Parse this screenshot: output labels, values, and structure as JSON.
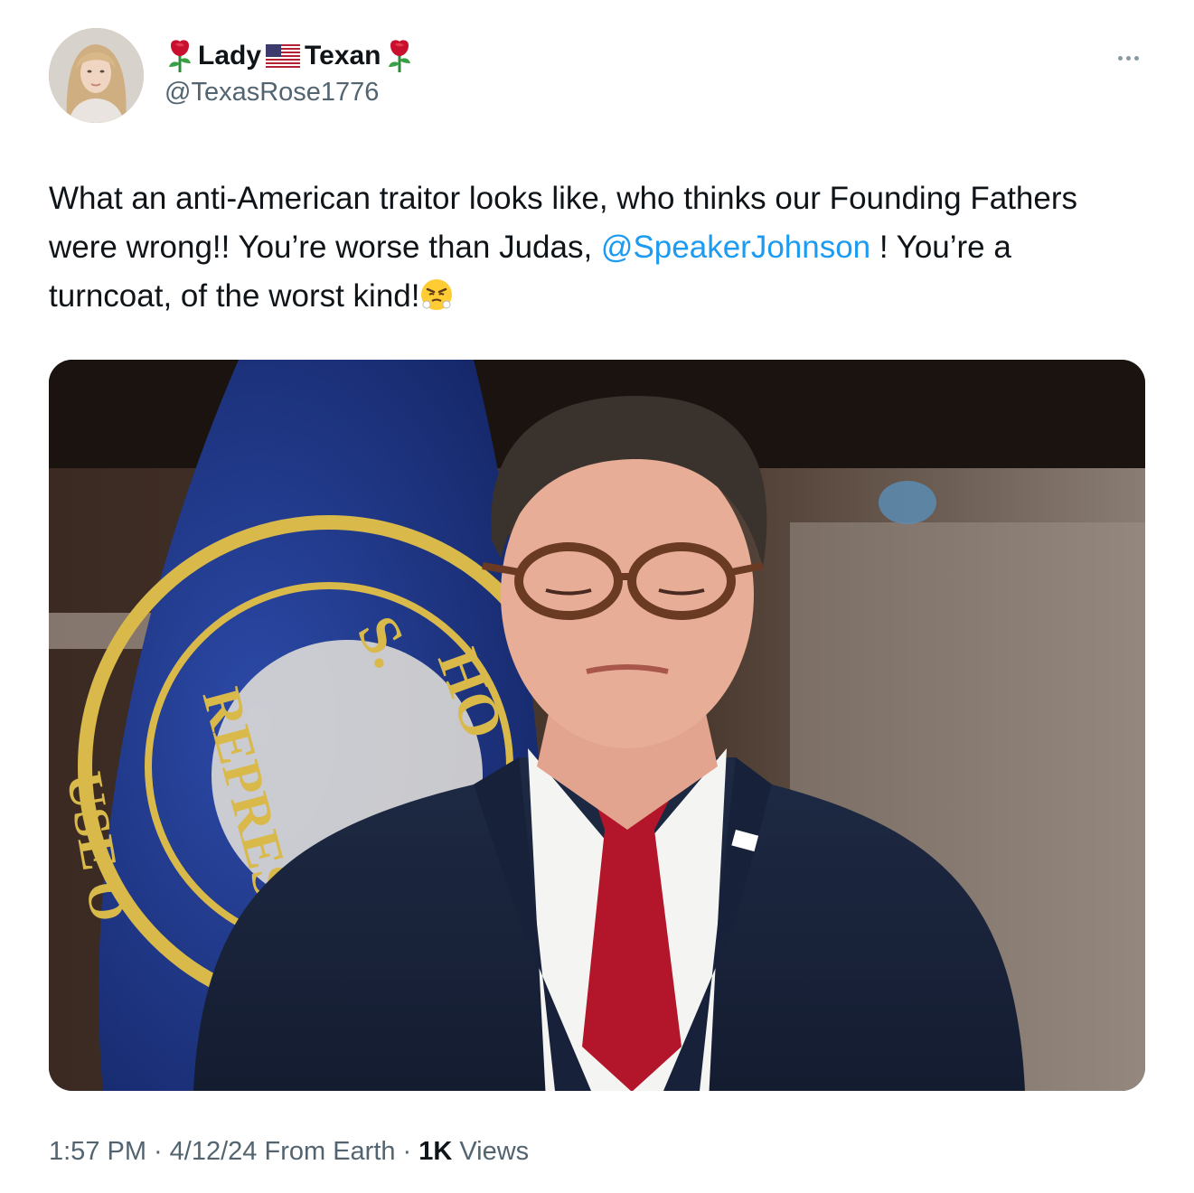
{
  "author": {
    "name_part1": "Lady",
    "name_part2": "Texan",
    "name_emojis": [
      "rose-icon",
      "us-flag-icon",
      "rose-icon"
    ],
    "handle": "@TexasRose1776"
  },
  "tweet": {
    "text_before_mention": "What an anti-American traitor looks like, who thinks our Founding Fathers were wrong!! You’re worse than Judas, ",
    "mention": "@SpeakerJohnson",
    "text_after_mention": " ! You’re a turncoat, of the worst kind!",
    "trailing_emoji": "steaming-angry-face-icon"
  },
  "meta": {
    "time": "1:57 PM",
    "separator": "·",
    "date": "4/12/24",
    "source": "From Earth",
    "views_count": "1K",
    "views_label": "Views"
  },
  "media": {
    "seal_text_visible": [
      "S.",
      "HO",
      "REPRES",
      "USE O"
    ]
  }
}
